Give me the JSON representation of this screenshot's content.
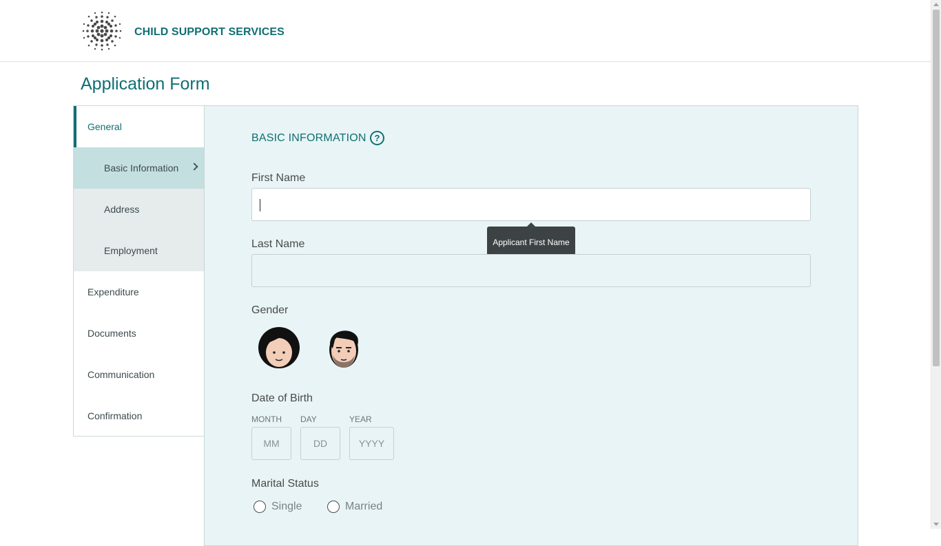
{
  "header": {
    "brand": "CHILD SUPPORT SERVICES",
    "logo_icon": "dotted-globe-logo"
  },
  "page": {
    "title": "Application Form"
  },
  "sidebar": {
    "items": [
      {
        "label": "General",
        "state": "active"
      },
      {
        "label": "Basic Information",
        "state": "current-sub"
      },
      {
        "label": "Address",
        "state": "sub"
      },
      {
        "label": "Employment",
        "state": "sub"
      },
      {
        "label": "Expenditure",
        "state": "normal"
      },
      {
        "label": "Documents",
        "state": "normal"
      },
      {
        "label": "Communication",
        "state": "normal"
      },
      {
        "label": "Confirmation",
        "state": "normal"
      }
    ]
  },
  "form": {
    "section_title": "BASIC INFORMATION",
    "help_icon": "?",
    "first_name": {
      "label": "First Name",
      "value": "",
      "tooltip": "Applicant First Name"
    },
    "last_name": {
      "label": "Last Name",
      "value": ""
    },
    "gender": {
      "label": "Gender",
      "options": [
        "female-avatar-icon",
        "male-avatar-icon"
      ]
    },
    "dob": {
      "label": "Date of Birth",
      "month": {
        "label": "MONTH",
        "placeholder": "MM"
      },
      "day": {
        "label": "DAY",
        "placeholder": "DD"
      },
      "year": {
        "label": "YEAR",
        "placeholder": "YYYY"
      }
    },
    "marital": {
      "label": "Marital Status",
      "options": [
        "Single",
        "Married"
      ]
    }
  },
  "colors": {
    "accent": "#0f6f73",
    "panel_bg": "#e8f4f5",
    "sub_nav_bg": "#e6ebeb",
    "current_nav_bg": "#c4dfe0"
  }
}
